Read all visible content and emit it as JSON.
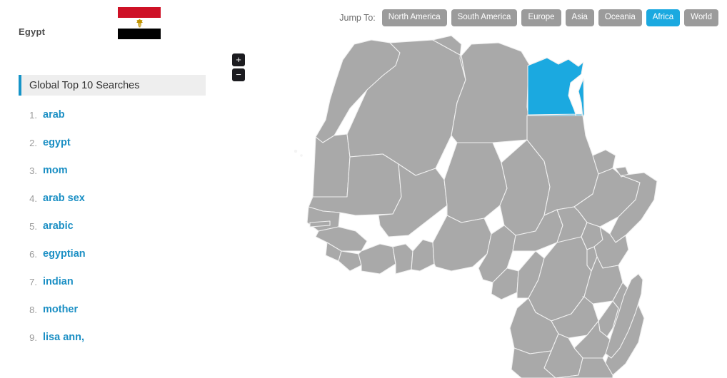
{
  "country": {
    "name": "Egypt",
    "flag_name": "egypt-flag",
    "flag_colors": {
      "red": "#ce1126",
      "white": "#ffffff",
      "black": "#000000",
      "emblem": "#c09300"
    }
  },
  "searches": {
    "title": "Global Top 10 Searches",
    "accent_color": "#1694c8",
    "items": [
      {
        "rank": "1.",
        "term": "arab"
      },
      {
        "rank": "2.",
        "term": "egypt"
      },
      {
        "rank": "3.",
        "term": "mom"
      },
      {
        "rank": "4.",
        "term": "arab sex"
      },
      {
        "rank": "5.",
        "term": "arabic"
      },
      {
        "rank": "6.",
        "term": "egyptian"
      },
      {
        "rank": "7.",
        "term": "indian"
      },
      {
        "rank": "8.",
        "term": "mother"
      },
      {
        "rank": "9.",
        "term": "lisa ann,"
      }
    ]
  },
  "jump_nav": {
    "label": "Jump To:",
    "active_color": "#1ba9e0",
    "inactive_color": "#9b9b9b",
    "buttons": [
      {
        "label": "North America",
        "active": false
      },
      {
        "label": "South America",
        "active": false
      },
      {
        "label": "Europe",
        "active": false
      },
      {
        "label": "Asia",
        "active": false
      },
      {
        "label": "Oceania",
        "active": false
      },
      {
        "label": "Africa",
        "active": true
      },
      {
        "label": "World",
        "active": false
      }
    ]
  },
  "map": {
    "region": "Africa",
    "selected_country": "Egypt",
    "land_color": "#a9a9a9",
    "selected_color": "#1ba9e0",
    "border_color": "#f0f0f0"
  },
  "zoom_controls": {
    "zoom_in_label": "+",
    "zoom_out_label": "−"
  }
}
